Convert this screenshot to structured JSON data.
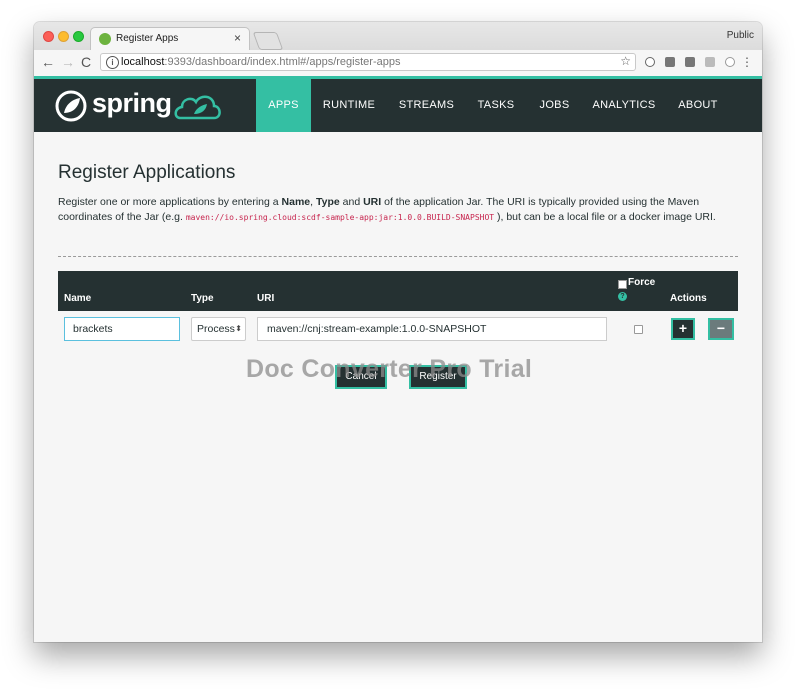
{
  "browser": {
    "tab_title": "Register Apps",
    "tab_close": "×",
    "profile_label": "Public",
    "url_host": "localhost",
    "url_rest": ":9393/dashboard/index.html#/apps/register-apps",
    "back": "←",
    "forward": "→",
    "reload": "C",
    "star": "☆",
    "info": "i",
    "menu": "⋮"
  },
  "header": {
    "logo_text": "spring",
    "nav": [
      {
        "label": "APPS",
        "active": true
      },
      {
        "label": "RUNTIME",
        "active": false
      },
      {
        "label": "STREAMS",
        "active": false
      },
      {
        "label": "TASKS",
        "active": false
      },
      {
        "label": "JOBS",
        "active": false
      },
      {
        "label": "ANALYTICS",
        "active": false
      },
      {
        "label": "ABOUT",
        "active": false
      }
    ],
    "accent_color": "#34bfa3",
    "bg_color": "#253132"
  },
  "page": {
    "title": "Register Applications",
    "desc_1": "Register one or more applications by entering a ",
    "desc_name": "Name",
    "desc_2": ", ",
    "desc_type": "Type",
    "desc_3": " and ",
    "desc_uri": "URI",
    "desc_4": " of the application Jar. The URI is typically provided using the Maven coordinates of the Jar (e.g. ",
    "desc_code": "maven://io.spring.cloud:scdf-sample-app:jar:1.0.0.BUILD-SNAPSHOT",
    "desc_5": " ), but can be a local file or a docker image URI."
  },
  "table": {
    "col_name": "Name",
    "col_type": "Type",
    "col_uri": "URI",
    "col_force": "Force",
    "col_actions": "Actions",
    "help": "?",
    "row": {
      "name": "brackets",
      "type": "Process",
      "type_arrow": "⬍",
      "uri": "maven://cnj:stream-example:1.0.0-SNAPSHOT",
      "force_checked": false
    },
    "add_label": "+",
    "remove_label": "−"
  },
  "buttons": {
    "cancel": "Cancel",
    "register": "Register"
  },
  "watermark": "Doc Converter Pro Trial"
}
